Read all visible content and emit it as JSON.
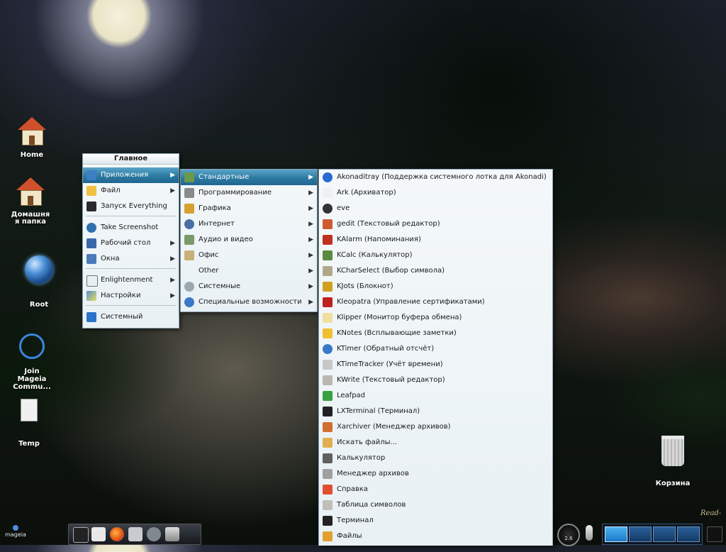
{
  "desktop": {
    "icons": [
      {
        "label": "Home"
      },
      {
        "label": "Домашня\nя папка"
      },
      {
        "label": "Root"
      },
      {
        "label": "Join\nMageia\nCommu..."
      },
      {
        "label": "Temp"
      },
      {
        "label": "Корзина"
      }
    ],
    "watermark": "Read-"
  },
  "main_menu": {
    "title": "Главное",
    "items": [
      {
        "label": "Приложения",
        "icon": "apps-icon"
      },
      {
        "label": "Файл",
        "icon": "file-icon"
      },
      {
        "label": "Запуск Everything",
        "icon": "terminal-icon"
      },
      {
        "label": "Take Screenshot",
        "icon": "screenshot-icon"
      },
      {
        "label": "Рабочий стол",
        "icon": "desktop-icon"
      },
      {
        "label": "Окна",
        "icon": "windows-icon"
      },
      {
        "label": "Enlightenment",
        "icon": "enlightenment-icon"
      },
      {
        "label": "Настройки",
        "icon": "settings-icon"
      },
      {
        "label": "Системный",
        "icon": "system-icon"
      }
    ]
  },
  "apps_menu": {
    "items": [
      {
        "label": "Стандартные",
        "icon": "accessories-icon"
      },
      {
        "label": "Программирование",
        "icon": "programming-icon"
      },
      {
        "label": "Графика",
        "icon": "graphics-icon"
      },
      {
        "label": "Интернет",
        "icon": "internet-icon"
      },
      {
        "label": "Аудио и видео",
        "icon": "multimedia-icon"
      },
      {
        "label": "Офис",
        "icon": "office-icon"
      },
      {
        "label": "Other",
        "icon": ""
      },
      {
        "label": "Системные",
        "icon": "system-tools-icon"
      },
      {
        "label": "Специальные возможности",
        "icon": "accessibility-icon"
      }
    ]
  },
  "accessories_menu": {
    "items": [
      {
        "label": "Akonaditray (Поддержка системного лотка для Akonadi)"
      },
      {
        "label": "Ark (Архиватор)"
      },
      {
        "label": "eve"
      },
      {
        "label": "gedit (Текстовый редактор)"
      },
      {
        "label": "KAlarm (Напоминания)"
      },
      {
        "label": "KCalc (Калькулятор)"
      },
      {
        "label": "KCharSelect (Выбор символа)"
      },
      {
        "label": "KJots (Блокнот)"
      },
      {
        "label": "Kleopatra (Управление сертификатами)"
      },
      {
        "label": "Klipper (Монитор буфера обмена)"
      },
      {
        "label": "KNotes (Всплывающие заметки)"
      },
      {
        "label": "KTimer (Обратный отсчёт)"
      },
      {
        "label": "KTimeTracker (Учёт времени)"
      },
      {
        "label": "KWrite (Текстовый редактор)"
      },
      {
        "label": "Leafpad"
      },
      {
        "label": "LXTerminal (Терминал)"
      },
      {
        "label": "Xarchiver (Менеджер архивов)"
      },
      {
        "label": "Искать файлы..."
      },
      {
        "label": "Калькулятор"
      },
      {
        "label": "Менеджер архивов"
      },
      {
        "label": "Справка"
      },
      {
        "label": "Таблица символов"
      },
      {
        "label": "Терминал"
      },
      {
        "label": "Файлы"
      }
    ]
  },
  "taskbar": {
    "logo": "mageia",
    "clock_value": "2.6"
  }
}
